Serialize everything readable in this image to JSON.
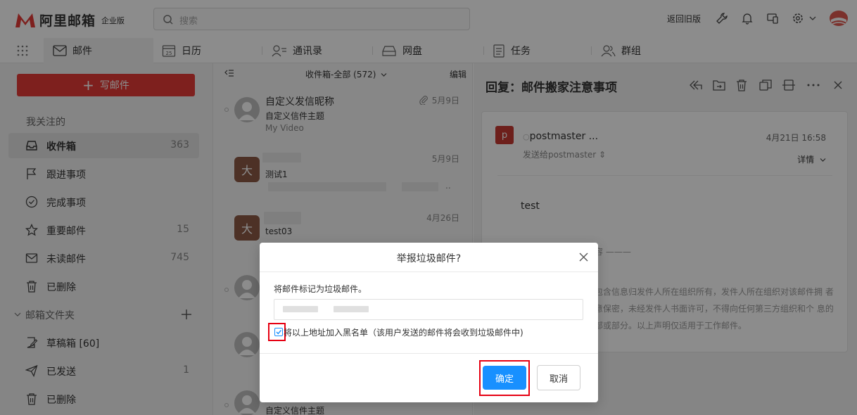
{
  "header": {
    "logo_text": "阿里邮箱",
    "edition": "企业版",
    "search_placeholder": "搜索",
    "back_old_label": "返回旧版"
  },
  "nav": {
    "tabs": [
      {
        "label": "邮件",
        "icon": "mail-icon",
        "active": true
      },
      {
        "label": "日历",
        "icon": "calendar-icon",
        "calendar_day": "25"
      },
      {
        "label": "通讯录",
        "icon": "contacts-icon"
      },
      {
        "label": "网盘",
        "icon": "drive-icon"
      },
      {
        "label": "任务",
        "icon": "task-icon"
      },
      {
        "label": "群组",
        "icon": "group-icon"
      }
    ]
  },
  "sidebar": {
    "compose_label": "写邮件",
    "favorites_heading": "我关注的",
    "items": [
      {
        "label": "收件箱",
        "count": "363",
        "icon": "inbox-icon",
        "active": true
      },
      {
        "label": "跟进事项",
        "count": "",
        "icon": "flag-icon"
      },
      {
        "label": "完成事项",
        "count": "",
        "icon": "check-circle-icon"
      },
      {
        "label": "重要邮件",
        "count": "15",
        "icon": "star-icon"
      },
      {
        "label": "未读邮件",
        "count": "745",
        "icon": "envelope-icon"
      },
      {
        "label": "已删除",
        "count": "",
        "icon": "trash-icon"
      }
    ],
    "folders_heading": "邮箱文件夹",
    "folders": [
      {
        "label": "草稿箱 [60]",
        "count": "",
        "icon": "draft-icon"
      },
      {
        "label": "已发送",
        "count": "1",
        "icon": "send-icon"
      },
      {
        "label": "已删除",
        "count": "",
        "icon": "trash-icon"
      }
    ]
  },
  "maillist": {
    "title": "收件箱-全部 (572)",
    "edit_label": "编辑",
    "mails": [
      {
        "from": "自定义发信昵称",
        "subject": "自定义信件主题",
        "preview": "My Video",
        "date": "5月9日",
        "avatar": "person",
        "attachment": true
      },
      {
        "from": "",
        "subject": "测试1",
        "preview": "..",
        "date": "5月9日",
        "avatar": "大"
      },
      {
        "from": "",
        "subject": "test03",
        "preview": "",
        "date": "4月26日",
        "avatar": "大"
      },
      {
        "from": "",
        "subject": "自定义信件主题",
        "preview": "",
        "date": "",
        "avatar": "person"
      }
    ]
  },
  "reader": {
    "title": "回复：邮件搬家注意事项",
    "sender": "postmaster ...",
    "sender_avatar": "p",
    "sent_to": "发送给postmaster",
    "time": "4月21日 16:58",
    "detail_label": "详情",
    "body": "test",
    "original_fragment": "内容 ———",
    "disclaimer": "件包含信息归发件人所在组织所有，发件人所在组织对该邮件拥 者注意保密，未经发件人书面许可，不得向任何第三方组织和个 息的全部或部分。以上声明仅适用于工作邮件。"
  },
  "dialog": {
    "title": "举报垃圾邮件?",
    "message": "将邮件标记为垃圾邮件。",
    "checkbox_label": "将以上地址加入黑名单（该用户发送的邮件将会收到垃圾邮件中)",
    "checkbox_checked": true,
    "ok_label": "确定",
    "cancel_label": "取消"
  },
  "colors": {
    "brand_red": "#e53b38",
    "primary_blue": "#1890ff",
    "highlight_red": "#e60012"
  }
}
